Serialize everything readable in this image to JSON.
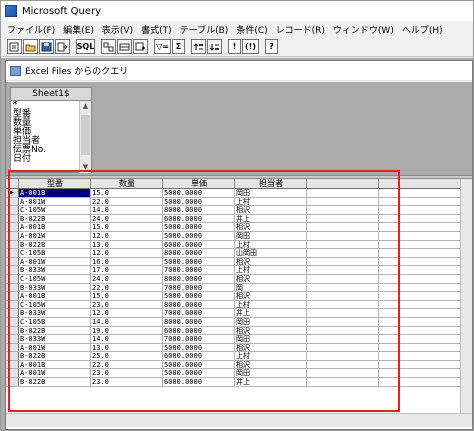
{
  "app": {
    "title": "Microsoft Query"
  },
  "menubar": {
    "items": [
      {
        "label": "ファイル(F)"
      },
      {
        "label": "編集(E)"
      },
      {
        "label": "表示(V)"
      },
      {
        "label": "書式(T)"
      },
      {
        "label": "テーブル(B)"
      },
      {
        "label": "条件(C)"
      },
      {
        "label": "レコード(R)"
      },
      {
        "label": "ウィンドウ(W)"
      },
      {
        "label": "ヘルプ(H)"
      }
    ]
  },
  "toolbar": {
    "sql_label": "SQL",
    "sum_label": "Σ",
    "equals_label": "▽=",
    "bang_label": "!",
    "bang_paren_label": "(!)",
    "help_label": "?"
  },
  "query_window": {
    "title": "Excel Files からのクエリ",
    "table": {
      "name": "Sheet1$",
      "fields": [
        "*",
        "型番",
        "数量",
        "単価",
        "担当者",
        "伝票No.",
        "日付"
      ]
    }
  },
  "grid": {
    "columns": [
      "型番",
      "数量",
      "単価",
      "担当者"
    ],
    "rows": [
      [
        "A-001B",
        "15.0",
        "5000.0000",
        "岡田"
      ],
      [
        "A-001W",
        "22.0",
        "5000.0000",
        "上村"
      ],
      [
        "C-105W",
        "14.0",
        "8000.0000",
        "相沢"
      ],
      [
        "B-022B",
        "24.0",
        "6000.0000",
        "井上"
      ],
      [
        "A-001B",
        "15.0",
        "5000.0000",
        "相沢"
      ],
      [
        "A-001W",
        "12.0",
        "5000.0000",
        "岡田"
      ],
      [
        "B-022B",
        "13.0",
        "6000.0000",
        "上村"
      ],
      [
        "C-105B",
        "12.0",
        "8000.0000",
        "山岡田"
      ],
      [
        "A-001W",
        "16.0",
        "5000.0000",
        "相沢"
      ],
      [
        "B-033W",
        "17.0",
        "7000.0000",
        "上村"
      ],
      [
        "C-105W",
        "24.0",
        "8000.0000",
        "相沢"
      ],
      [
        "B-033W",
        "22.0",
        "7000.0000",
        "岡"
      ],
      [
        "A-001B",
        "15.0",
        "5000.0000",
        "相沢"
      ],
      [
        "C-105W",
        "23.0",
        "8000.0000",
        "上村"
      ],
      [
        "B-033W",
        "12.0",
        "7000.0000",
        "井上"
      ],
      [
        "C-105B",
        "14.0",
        "8000.0000",
        "岡田"
      ],
      [
        "B-022B",
        "19.0",
        "6000.0000",
        "相沢"
      ],
      [
        "B-033W",
        "14.0",
        "7000.0000",
        "岡田"
      ],
      [
        "A-001W",
        "13.0",
        "5000.0000",
        "相沢"
      ],
      [
        "B-022B",
        "25.0",
        "6000.0000",
        "上村"
      ],
      [
        "A-001B",
        "22.0",
        "5000.0000",
        "相沢"
      ],
      [
        "A-001W",
        "23.0",
        "5000.0000",
        "岡田"
      ],
      [
        "B-022B",
        "23.0",
        "6000.0000",
        "井上"
      ]
    ]
  },
  "colors": {
    "selection": "#000080",
    "highlight_outline": "#e81e2a"
  }
}
